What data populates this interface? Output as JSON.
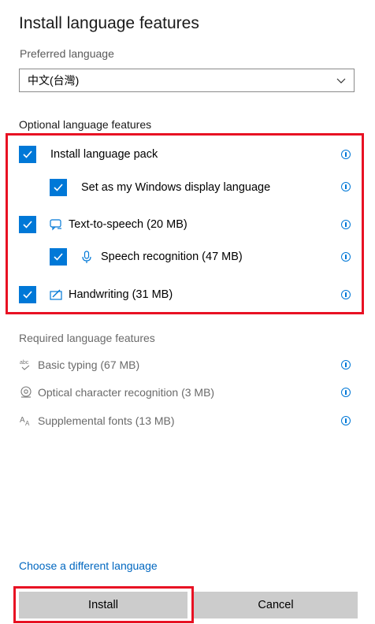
{
  "dialog": {
    "title": "Install language features",
    "preferred_label": "Preferred language",
    "preferred_value": "中文(台灣)",
    "optional_heading": "Optional language features",
    "optional_items": [
      {
        "label": "Install language pack",
        "checked": true
      },
      {
        "label": "Set as my Windows display language",
        "checked": true
      },
      {
        "label": "Text-to-speech (20 MB)",
        "checked": true,
        "icon": "speech-bubble-icon"
      },
      {
        "label": "Speech recognition (47 MB)",
        "checked": true,
        "icon": "microphone-icon"
      },
      {
        "label": "Handwriting (31 MB)",
        "checked": true,
        "icon": "pen-icon"
      }
    ],
    "required_heading": "Required language features",
    "required_items": [
      {
        "label": "Basic typing (67 MB)",
        "icon": "abc-check-icon"
      },
      {
        "label": "Optical character recognition (3 MB)",
        "icon": "scan-eye-icon"
      },
      {
        "label": "Supplemental fonts (13 MB)",
        "icon": "font-aa-icon"
      }
    ],
    "choose_link": "Choose a different language",
    "install_label": "Install",
    "cancel_label": "Cancel"
  },
  "colors": {
    "accent": "#0078d7",
    "highlight": "#e81123",
    "button_bg": "#cccccc"
  }
}
